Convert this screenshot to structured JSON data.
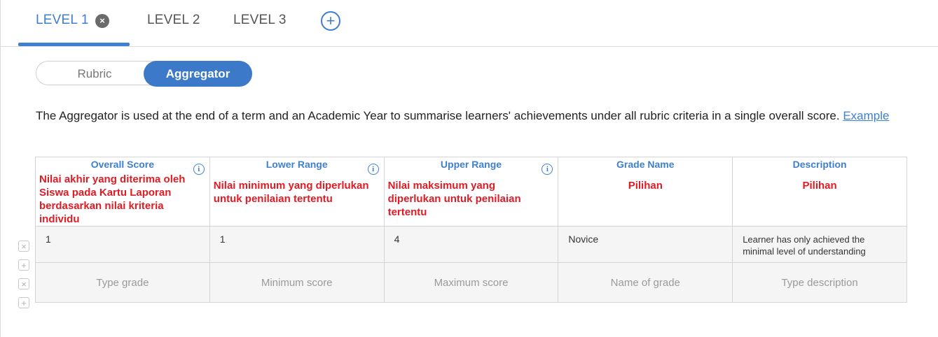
{
  "tabs": [
    {
      "label": "LEVEL 1",
      "active": true
    },
    {
      "label": "LEVEL 2",
      "active": false
    },
    {
      "label": "LEVEL 3",
      "active": false
    }
  ],
  "icons": {
    "tab_close": "×",
    "tab_add": "+",
    "info": "i",
    "row_delete": "×",
    "row_add": "+"
  },
  "toggle": {
    "rubric": "Rubric",
    "aggregator": "Aggregator"
  },
  "intro": {
    "text": "The Aggregator is used at the end of a term and an Academic Year to summarise learners' achievements under all rubric criteria in a single overall score.",
    "link": "Example"
  },
  "table": {
    "columns": [
      {
        "title": "Overall Score",
        "note": "Nilai akhir yang diterima oleh Siswa pada Kartu Laporan berdasarkan nilai kriteria individu"
      },
      {
        "title": "Lower Range",
        "note": "Nilai minimum yang diperlukan untuk penilaian tertentu"
      },
      {
        "title": "Upper Range",
        "note": "Nilai maksimum yang diperlukan untuk penilaian tertentu"
      },
      {
        "title": "Grade Name",
        "note": "Pilihan"
      },
      {
        "title": "Description",
        "note": "Pilihan"
      }
    ],
    "row": {
      "overall": "1",
      "lower": "1",
      "upper": "4",
      "grade": "Novice",
      "description": "Learner has only achieved the minimal level of understanding"
    },
    "placeholders": {
      "overall": "Type grade",
      "lower": "Minimum score",
      "upper": "Maximum score",
      "grade": "Name of grade",
      "description": "Type description"
    }
  },
  "colors": {
    "accent": "#3f7fd0",
    "annotation": "#e01b24"
  }
}
